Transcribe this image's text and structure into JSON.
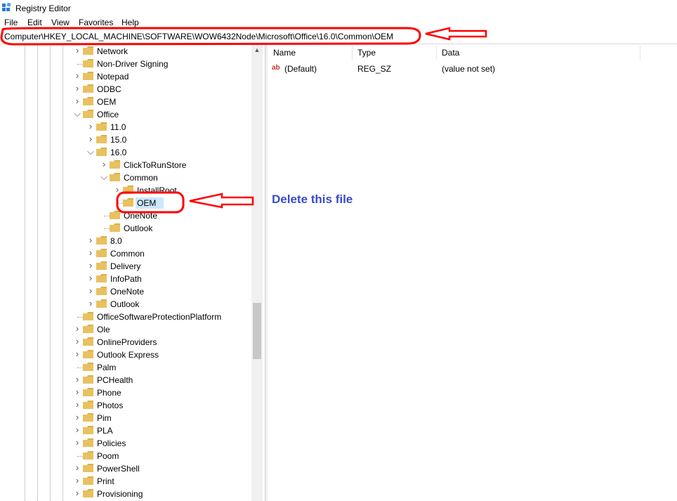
{
  "window": {
    "title": "Registry Editor"
  },
  "menu": [
    "File",
    "Edit",
    "View",
    "Favorites",
    "Help"
  ],
  "address": {
    "path": "Computer\\HKEY_LOCAL_MACHINE\\SOFTWARE\\WOW6432Node\\Microsoft\\Office\\16.0\\Common\\OEM"
  },
  "tree": [
    {
      "label": "Network",
      "depth": 0,
      "expander": "collapsed"
    },
    {
      "label": "Non-Driver Signing",
      "depth": 0,
      "expander": "none"
    },
    {
      "label": "Notepad",
      "depth": 0,
      "expander": "collapsed"
    },
    {
      "label": "ODBC",
      "depth": 0,
      "expander": "collapsed"
    },
    {
      "label": "OEM",
      "depth": 0,
      "expander": "collapsed"
    },
    {
      "label": "Office",
      "depth": 0,
      "expander": "expanded"
    },
    {
      "label": "11.0",
      "depth": 1,
      "expander": "collapsed"
    },
    {
      "label": "15.0",
      "depth": 1,
      "expander": "collapsed"
    },
    {
      "label": "16.0",
      "depth": 1,
      "expander": "expanded"
    },
    {
      "label": "ClickToRunStore",
      "depth": 2,
      "expander": "collapsed"
    },
    {
      "label": "Common",
      "depth": 2,
      "expander": "expanded"
    },
    {
      "label": "InstallRoot",
      "depth": 3,
      "expander": "collapsed"
    },
    {
      "label": "OEM",
      "depth": 3,
      "expander": "none",
      "selected": true
    },
    {
      "label": "OneNote",
      "depth": 2,
      "expander": "none"
    },
    {
      "label": "Outlook",
      "depth": 2,
      "expander": "none"
    },
    {
      "label": "8.0",
      "depth": 1,
      "expander": "collapsed"
    },
    {
      "label": "Common",
      "depth": 1,
      "expander": "collapsed"
    },
    {
      "label": "Delivery",
      "depth": 1,
      "expander": "collapsed"
    },
    {
      "label": "InfoPath",
      "depth": 1,
      "expander": "collapsed"
    },
    {
      "label": "OneNote",
      "depth": 1,
      "expander": "collapsed"
    },
    {
      "label": "Outlook",
      "depth": 1,
      "expander": "collapsed"
    },
    {
      "label": "OfficeSoftwareProtectionPlatform",
      "depth": 0,
      "expander": "none"
    },
    {
      "label": "Ole",
      "depth": 0,
      "expander": "collapsed"
    },
    {
      "label": "OnlineProviders",
      "depth": 0,
      "expander": "collapsed"
    },
    {
      "label": "Outlook Express",
      "depth": 0,
      "expander": "collapsed"
    },
    {
      "label": "Palm",
      "depth": 0,
      "expander": "none"
    },
    {
      "label": "PCHealth",
      "depth": 0,
      "expander": "collapsed"
    },
    {
      "label": "Phone",
      "depth": 0,
      "expander": "collapsed"
    },
    {
      "label": "Photos",
      "depth": 0,
      "expander": "collapsed"
    },
    {
      "label": "Pim",
      "depth": 0,
      "expander": "collapsed"
    },
    {
      "label": "PLA",
      "depth": 0,
      "expander": "collapsed"
    },
    {
      "label": "Policies",
      "depth": 0,
      "expander": "collapsed"
    },
    {
      "label": "Poom",
      "depth": 0,
      "expander": "none"
    },
    {
      "label": "PowerShell",
      "depth": 0,
      "expander": "collapsed"
    },
    {
      "label": "Print",
      "depth": 0,
      "expander": "collapsed"
    },
    {
      "label": "Provisioning",
      "depth": 0,
      "expander": "collapsed"
    }
  ],
  "list": {
    "columns": [
      "Name",
      "Type",
      "Data"
    ],
    "rows": [
      {
        "name": "(Default)",
        "type": "REG_SZ",
        "data": "(value not set)",
        "icon": "string-value-icon"
      }
    ]
  },
  "annotation": {
    "text": "Delete this file"
  },
  "colors": {
    "annotation": "#3b4bc8",
    "highlight": "#ff0000",
    "folder": "#e8c160",
    "selection": "#cce8ff"
  }
}
